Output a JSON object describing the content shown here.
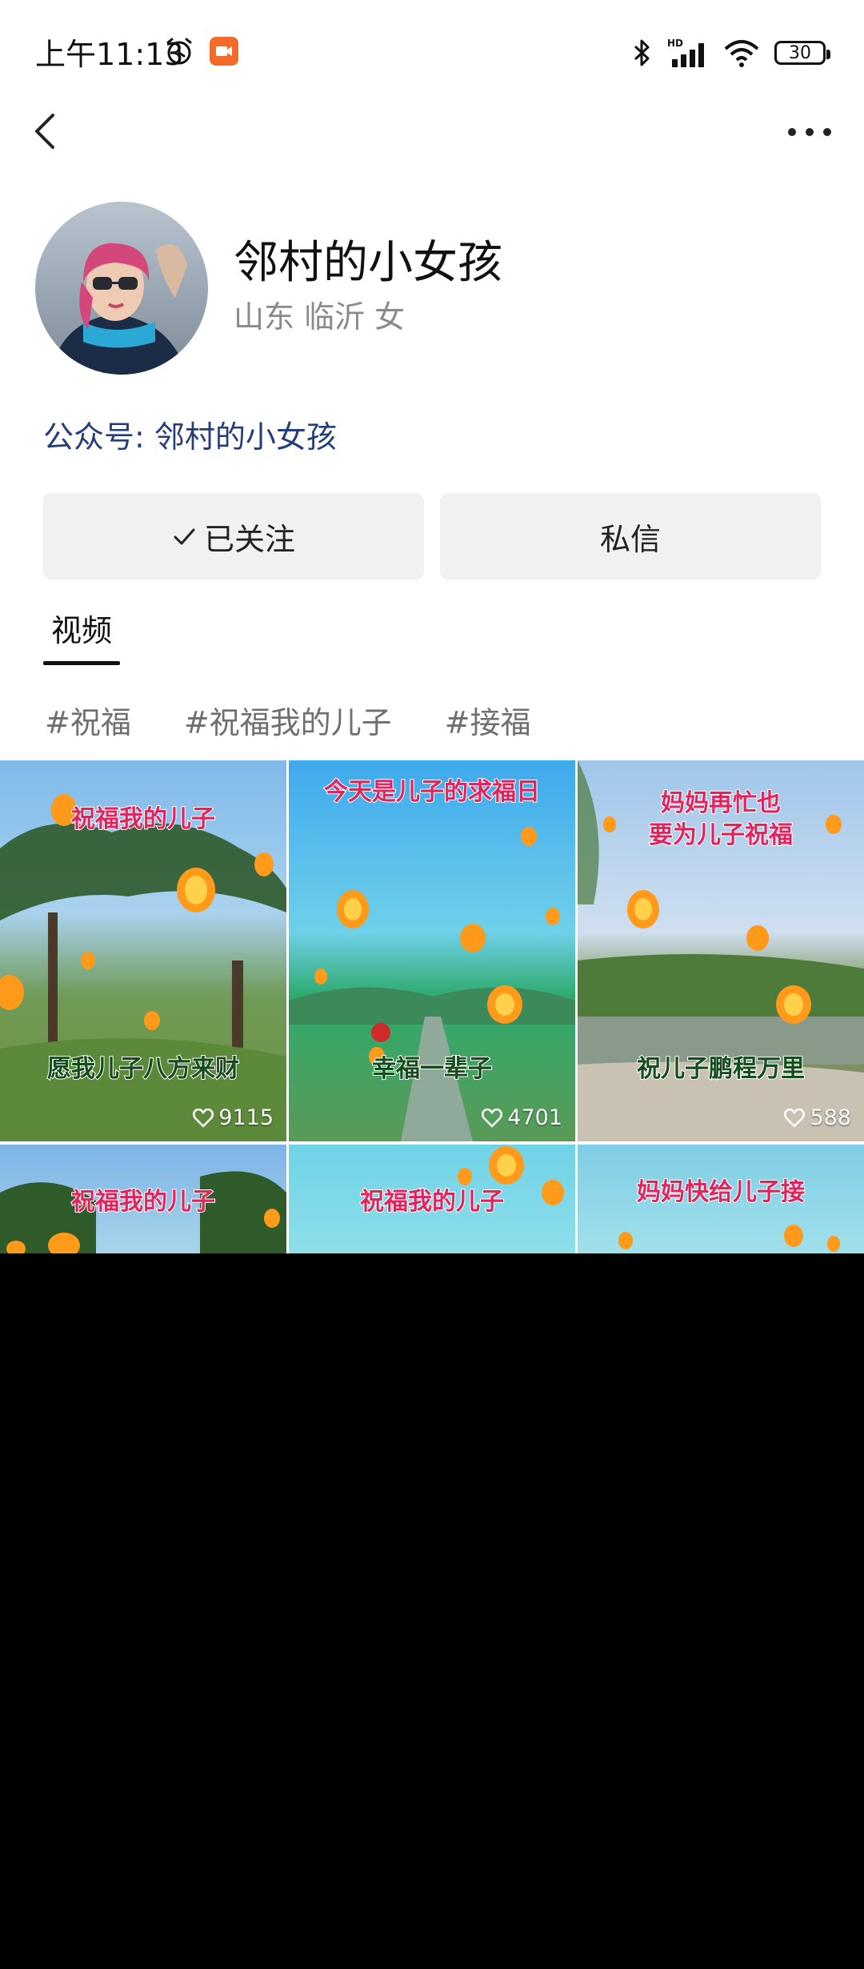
{
  "status_bar": {
    "time": "上午11:13",
    "battery": "30",
    "icons": [
      "alarm-icon",
      "video-record-icon",
      "bluetooth-icon",
      "hd-signal-icon",
      "wifi-icon",
      "battery-icon"
    ]
  },
  "nav": {
    "back_icon": "chevron-left-icon",
    "more_icon": "more-dots-icon"
  },
  "profile": {
    "name": "邻村的小女孩",
    "location": "山东 临沂 女",
    "public_account": "公众号: 邻村的小女孩"
  },
  "actions": {
    "follow_label": "已关注",
    "message_label": "私信"
  },
  "tabs": {
    "video": "视频"
  },
  "hashtags": [
    "#祝福",
    "#祝福我的儿子",
    "#接福"
  ],
  "videos": [
    {
      "caption_top": "祝福我的儿子",
      "caption_bottom": "愿我儿子八方来财",
      "likes": "9115"
    },
    {
      "caption_top": "今天是儿子的求福日",
      "caption_bottom": "幸福一辈子",
      "likes": "4701"
    },
    {
      "caption_top": "妈妈再忙也",
      "caption_top2": "要为儿子祝福",
      "caption_bottom": "祝儿子鹏程万里",
      "likes": "588"
    },
    {
      "caption_top": "祝福我的儿子"
    },
    {
      "caption_top": "祝福我的儿子"
    },
    {
      "caption_top": "妈妈快给儿子接"
    }
  ],
  "colors": {
    "link": "#243e7a",
    "button_bg": "#f1f1f1",
    "caption_red": "#e0245e",
    "caption_dark": "#174d1e"
  }
}
